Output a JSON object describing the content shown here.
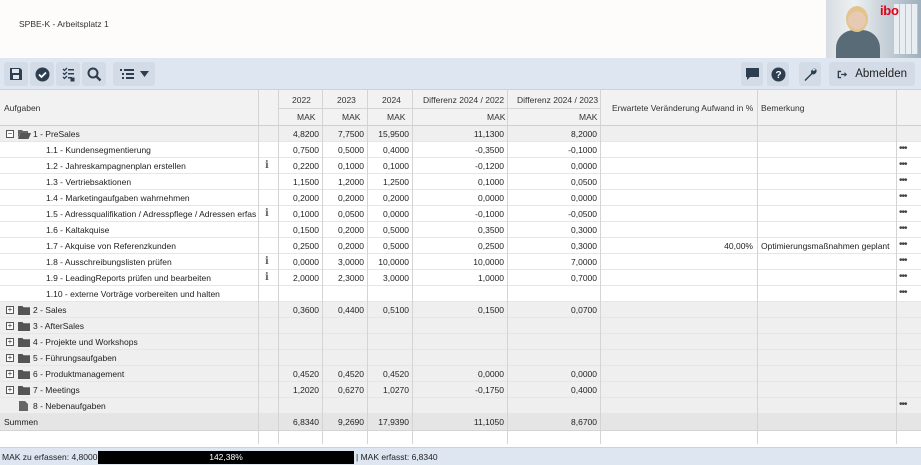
{
  "app": {
    "title": "SPBE-K - Arbeitsplatz 1",
    "logo_text": "ibo"
  },
  "toolbar": {
    "left_icons": [
      "save-icon",
      "check-icon",
      "checklist-icon",
      "search-icon",
      "list-icon",
      "chevron-down-icon"
    ],
    "right_icons": [
      "chat-icon",
      "help-icon",
      "wrench-icon",
      "logout-icon"
    ],
    "logout_label": "Abmelden",
    "accent": "#dde6f1"
  },
  "table": {
    "headers": {
      "task": "Aufgaben",
      "y2022": "2022",
      "y2023": "2023",
      "y2024": "2024",
      "diff1": "Differenz 2024 / 2022",
      "diff2": "Differenz 2024 / 2023",
      "expected": "Erwartete Veränderung Aufwand in %",
      "remark": "Bemerkung",
      "unit": "MAK"
    },
    "rows": [
      {
        "label": "1 - PreSales",
        "level": 0,
        "toggle": "−",
        "folder": "open",
        "info": false,
        "v2022": "4,8200",
        "v2023": "7,7500",
        "v2024": "15,9500",
        "d1": "11,1300",
        "d2": "8,2000",
        "exp": "",
        "remark": "",
        "dots": false
      },
      {
        "label": "1.1 - Kundensegmentierung",
        "level": 1,
        "info": false,
        "v2022": "0,7500",
        "v2023": "0,5000",
        "v2024": "0,4000",
        "d1": "-0,3500",
        "d2": "-0,1000",
        "exp": "",
        "remark": "",
        "dots": true
      },
      {
        "label": "1.2 - Jahreskampagnenplan erstellen",
        "level": 1,
        "info": true,
        "v2022": "0,2200",
        "v2023": "0,1000",
        "v2024": "0,1000",
        "d1": "-0,1200",
        "d2": "0,0000",
        "exp": "",
        "remark": "",
        "dots": true
      },
      {
        "label": "1.3 - Vertriebsaktionen",
        "level": 1,
        "info": false,
        "v2022": "1,1500",
        "v2023": "1,2000",
        "v2024": "1,2500",
        "d1": "0,1000",
        "d2": "0,0500",
        "exp": "",
        "remark": "",
        "dots": true
      },
      {
        "label": "1.4 - Marketingaufgaben wahrnehmen",
        "level": 1,
        "info": false,
        "v2022": "0,2000",
        "v2023": "0,2000",
        "v2024": "0,2000",
        "d1": "0,0000",
        "d2": "0,0000",
        "exp": "",
        "remark": "",
        "dots": true
      },
      {
        "label": "1.5 - Adressqualifikation / Adresspflege / Adressen erfas...",
        "level": 1,
        "info": true,
        "v2022": "0,1000",
        "v2023": "0,0500",
        "v2024": "0,0000",
        "d1": "-0,1000",
        "d2": "-0,0500",
        "exp": "",
        "remark": "",
        "dots": true
      },
      {
        "label": "1.6 - Kaltakquise",
        "level": 1,
        "info": false,
        "v2022": "0,1500",
        "v2023": "0,2000",
        "v2024": "0,5000",
        "d1": "0,3500",
        "d2": "0,3000",
        "exp": "",
        "remark": "",
        "dots": true
      },
      {
        "label": "1.7 - Akquise von Referenzkunden",
        "level": 1,
        "info": false,
        "v2022": "0,2500",
        "v2023": "0,2000",
        "v2024": "0,5000",
        "d1": "0,2500",
        "d2": "0,3000",
        "exp": "40,00%",
        "remark": "Optimierungsmaßnahmen geplant",
        "dots": true
      },
      {
        "label": "1.8 - Ausschreibungslisten prüfen",
        "level": 1,
        "info": true,
        "v2022": "0,0000",
        "v2023": "3,0000",
        "v2024": "10,0000",
        "d1": "10,0000",
        "d2": "7,0000",
        "exp": "",
        "remark": "",
        "dots": true
      },
      {
        "label": "1.9 - LeadingReports prüfen und bearbeiten",
        "level": 1,
        "info": true,
        "v2022": "2,0000",
        "v2023": "2,3000",
        "v2024": "3,0000",
        "d1": "1,0000",
        "d2": "0,7000",
        "exp": "",
        "remark": "",
        "dots": true
      },
      {
        "label": "1.10 - externe Vorträge vorbereiten und halten",
        "level": 1,
        "info": false,
        "v2022": "",
        "v2023": "",
        "v2024": "",
        "d1": "",
        "d2": "",
        "exp": "",
        "remark": "",
        "dots": true
      },
      {
        "label": "2 - Sales",
        "level": 0,
        "toggle": "+",
        "folder": "closed",
        "info": false,
        "v2022": "0,3600",
        "v2023": "0,4400",
        "v2024": "0,5100",
        "d1": "0,1500",
        "d2": "0,0700",
        "exp": "",
        "remark": "",
        "dots": false
      },
      {
        "label": "3 - AfterSales",
        "level": 0,
        "toggle": "+",
        "folder": "closed",
        "info": false,
        "v2022": "",
        "v2023": "",
        "v2024": "",
        "d1": "",
        "d2": "",
        "exp": "",
        "remark": "",
        "dots": false
      },
      {
        "label": "4 - Projekte und Workshops",
        "level": 0,
        "toggle": "+",
        "folder": "closed",
        "info": false,
        "v2022": "",
        "v2023": "",
        "v2024": "",
        "d1": "",
        "d2": "",
        "exp": "",
        "remark": "",
        "dots": false
      },
      {
        "label": "5 - Führungsaufgaben",
        "level": 0,
        "toggle": "+",
        "folder": "closed",
        "info": false,
        "v2022": "",
        "v2023": "",
        "v2024": "",
        "d1": "",
        "d2": "",
        "exp": "",
        "remark": "",
        "dots": false
      },
      {
        "label": "6 - Produktmanagement",
        "level": 0,
        "toggle": "+",
        "folder": "closed",
        "info": false,
        "v2022": "0,4520",
        "v2023": "0,4520",
        "v2024": "0,4520",
        "d1": "0,0000",
        "d2": "0,0000",
        "exp": "",
        "remark": "",
        "dots": false
      },
      {
        "label": "7 - Meetings",
        "level": 0,
        "toggle": "+",
        "folder": "closed",
        "info": false,
        "v2022": "1,2020",
        "v2023": "0,6270",
        "v2024": "1,0270",
        "d1": "-0,1750",
        "d2": "0,4000",
        "exp": "",
        "remark": "",
        "dots": false
      },
      {
        "label": "8 - Nebenaufgaben",
        "level": 0,
        "toggle": "",
        "folder": "file",
        "info": false,
        "v2022": "",
        "v2023": "",
        "v2024": "",
        "d1": "",
        "d2": "",
        "exp": "",
        "remark": "",
        "dots": true
      }
    ],
    "summary": {
      "label": "Summen",
      "v2022": "6,8340",
      "v2023": "9,2690",
      "v2024": "17,9390",
      "d1": "11,1050",
      "d2": "8,6700"
    }
  },
  "status": {
    "left": "MAK zu erfassen: 4,8000 |",
    "progress": "142,38%",
    "right": "| MAK erfasst: 6,8340"
  }
}
